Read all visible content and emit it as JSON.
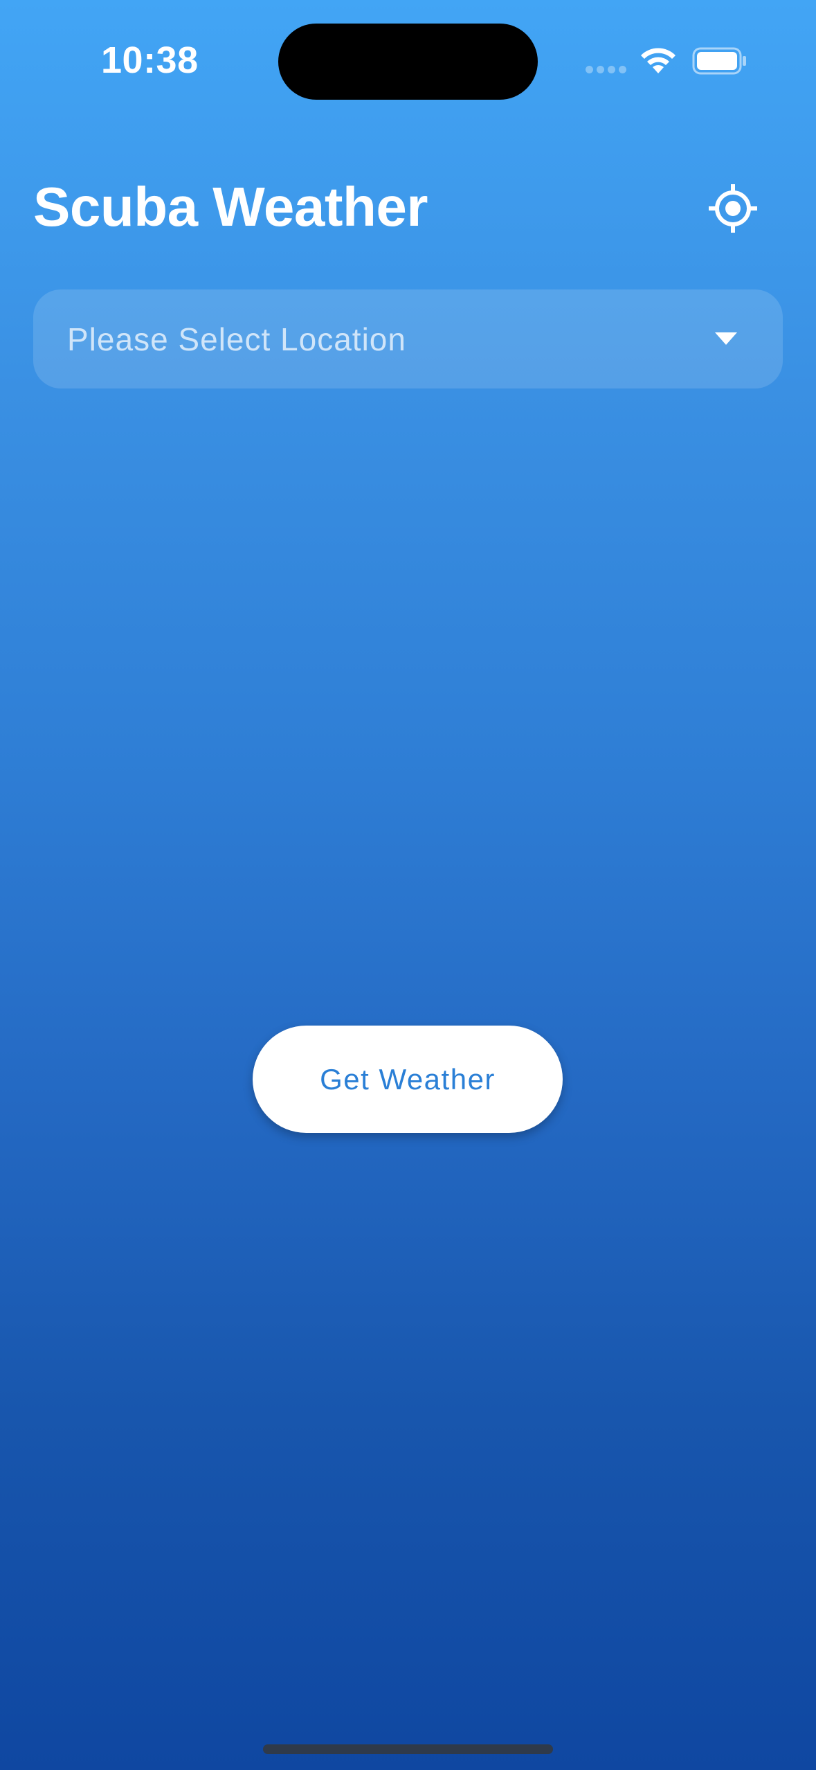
{
  "status_bar": {
    "time": "10:38"
  },
  "header": {
    "title": "Scuba Weather",
    "locate_icon": "gps-crosshair-icon"
  },
  "location_select": {
    "placeholder": "Please Select Location",
    "arrow_icon": "dropdown-caret-icon"
  },
  "actions": {
    "get_weather_label": "Get Weather"
  },
  "colors": {
    "gradient_top": "#42a5f5",
    "gradient_bottom": "#0f47a1",
    "button_text": "#2a7fd6",
    "title": "#ffffff"
  }
}
